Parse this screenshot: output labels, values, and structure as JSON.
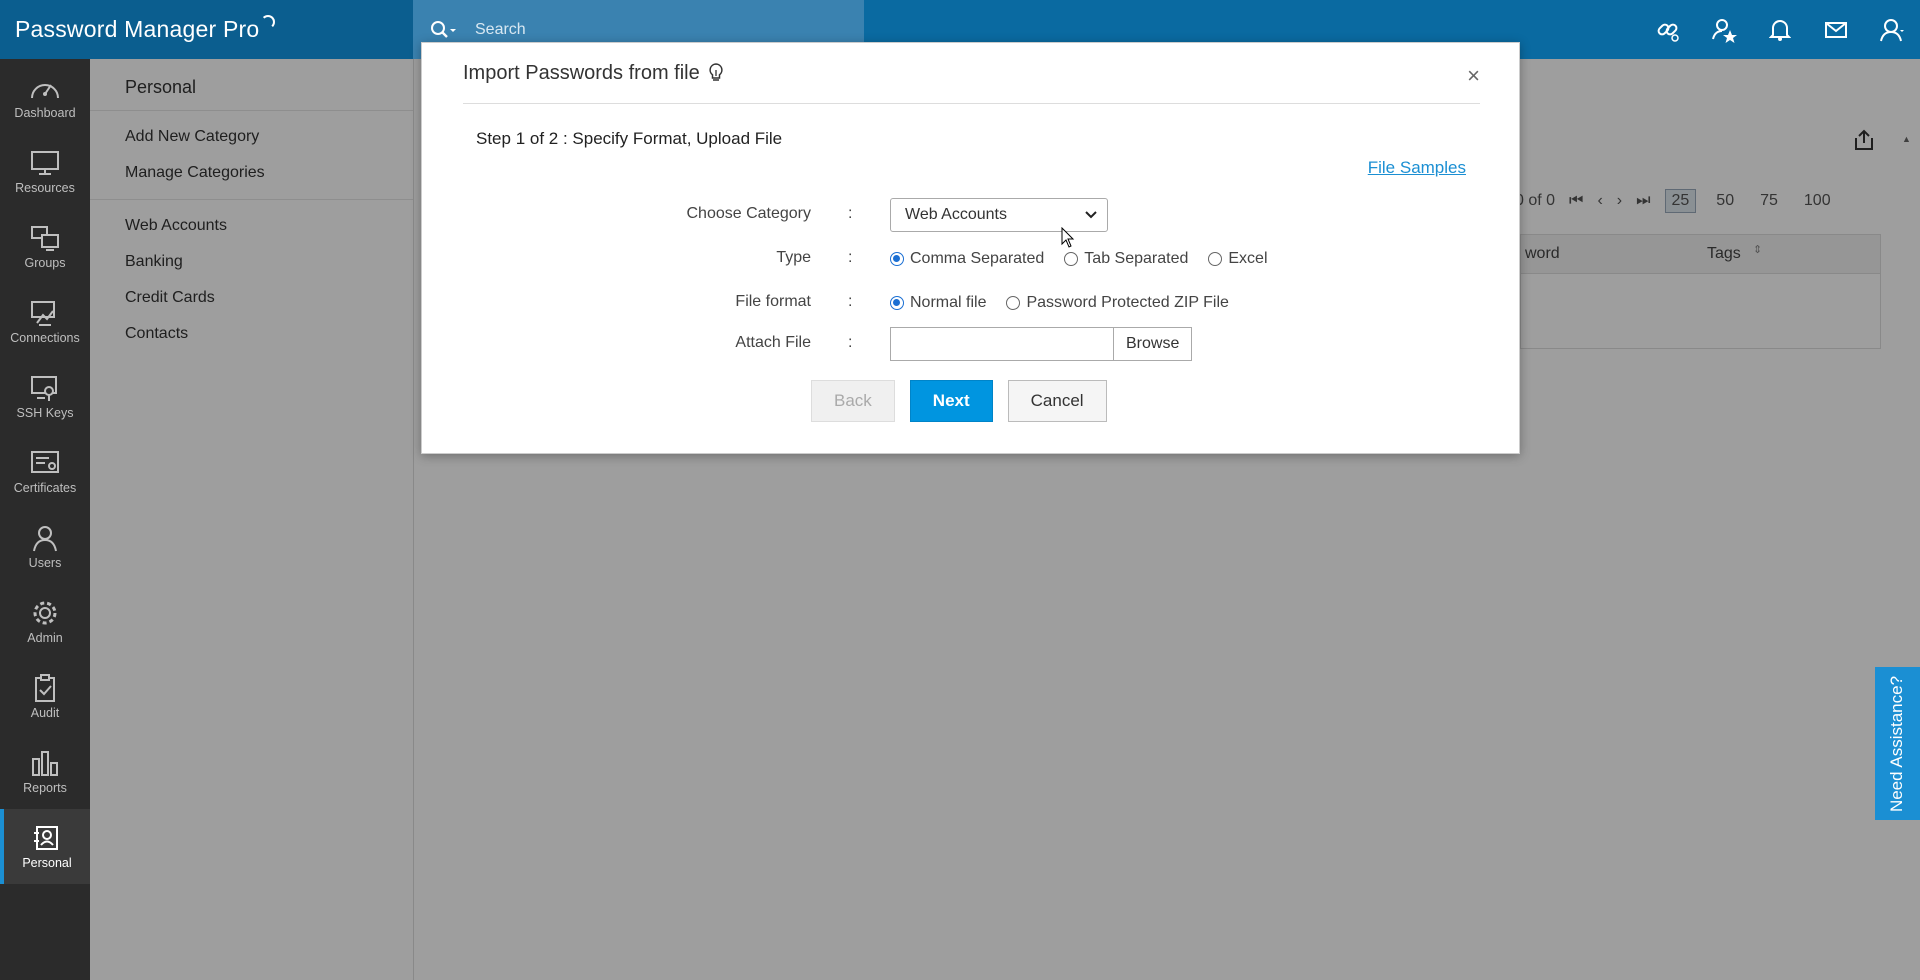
{
  "header": {
    "brand": "Password Manager Pro",
    "search_placeholder": "Search"
  },
  "leftnav": [
    {
      "label": "Dashboard",
      "icon": "dashboard-icon"
    },
    {
      "label": "Resources",
      "icon": "monitor-icon"
    },
    {
      "label": "Groups",
      "icon": "groups-icon"
    },
    {
      "label": "Connections",
      "icon": "connections-icon"
    },
    {
      "label": "SSH Keys",
      "icon": "ssh-key-icon"
    },
    {
      "label": "Certificates",
      "icon": "certificate-icon"
    },
    {
      "label": "Users",
      "icon": "user-icon"
    },
    {
      "label": "Admin",
      "icon": "gear-icon"
    },
    {
      "label": "Audit",
      "icon": "clipboard-icon"
    },
    {
      "label": "Reports",
      "icon": "bar-chart-icon"
    },
    {
      "label": "Personal",
      "icon": "personal-icon",
      "active": true
    }
  ],
  "subnav": {
    "title": "Personal",
    "actions": [
      "Add New Category",
      "Manage Categories"
    ],
    "categories": [
      "Web Accounts",
      "Banking",
      "Credit Cards",
      "Contacts"
    ]
  },
  "main": {
    "pager_text": "0 of 0",
    "page_sizes": [
      "25",
      "50",
      "75",
      "100"
    ],
    "selected_page_size": "25",
    "col_password": "word",
    "col_tags": "Tags"
  },
  "modal": {
    "title": "Import Passwords from file",
    "close": "×",
    "step": "Step 1 of 2 : Specify Format, Upload File",
    "file_samples": "File Samples",
    "colon": ":",
    "category": {
      "label": "Choose Category",
      "value": "Web Accounts"
    },
    "type": {
      "label": "Type",
      "options": [
        "Comma Separated",
        "Tab Separated",
        "Excel"
      ],
      "selected": "Comma Separated"
    },
    "file_format": {
      "label": "File format",
      "options": [
        "Normal file",
        "Password Protected ZIP File"
      ],
      "selected": "Normal file"
    },
    "attach": {
      "label": "Attach File",
      "browse": "Browse"
    },
    "buttons": {
      "back": "Back",
      "next": "Next",
      "cancel": "Cancel"
    }
  },
  "assist": "Need Assistance?",
  "colors": {
    "header": "#0a6aa1",
    "accent": "#0095e0",
    "nav_bg": "#2b2b2b"
  }
}
